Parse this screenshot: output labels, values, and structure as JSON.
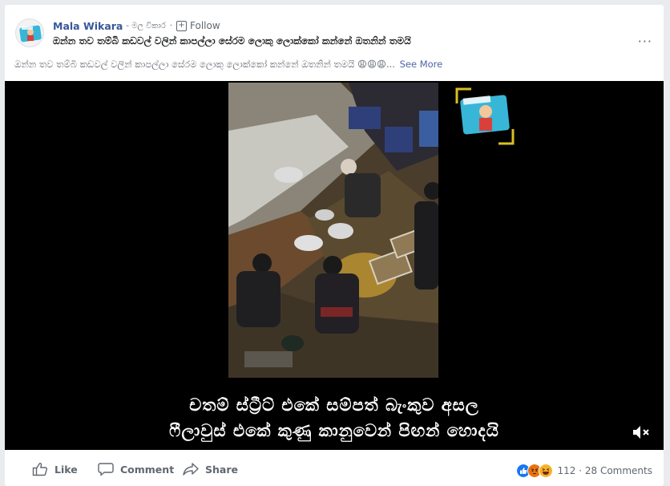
{
  "post": {
    "author_name": "Mala Wikara",
    "author_sub": "- මල විකාර",
    "separator": "·",
    "follow_label": "Follow",
    "title": "ඔන්න තව තම්බි කඩවල් වලින් කාපල්ලා සේරම ලොකු ලොක්කෝ කන්නේ ඔතනින් තමයි",
    "body_text": "ඔන්න තව තම්බි කඩවල් වලින් කාපල්ලා සේරම ලොකු ලොක්කෝ කන්නේ ඔතනින් තමයි 😩😩😩...",
    "see_more_label": "See More",
    "more_label": "···"
  },
  "video": {
    "subtitle_line1": "චතම් ස්ට්‍රීට් එකේ  සම්පත්  බැංකුව  අසල",
    "subtitle_line2": "ෆීලාවුස්  එකේ  කුණු  කානුවෙන්  පිඟන්  හොදයි"
  },
  "actions": {
    "like_label": "Like",
    "comment_label": "Comment",
    "share_label": "Share"
  },
  "reactions": {
    "icons": [
      "like-reaction-icon",
      "angry-reaction-icon",
      "haha-reaction-icon"
    ],
    "colors": {
      "like": "#1877f2",
      "angry": "#e9710f",
      "haha": "#f7b125"
    },
    "counts_text": "112 · 28 Comments"
  }
}
